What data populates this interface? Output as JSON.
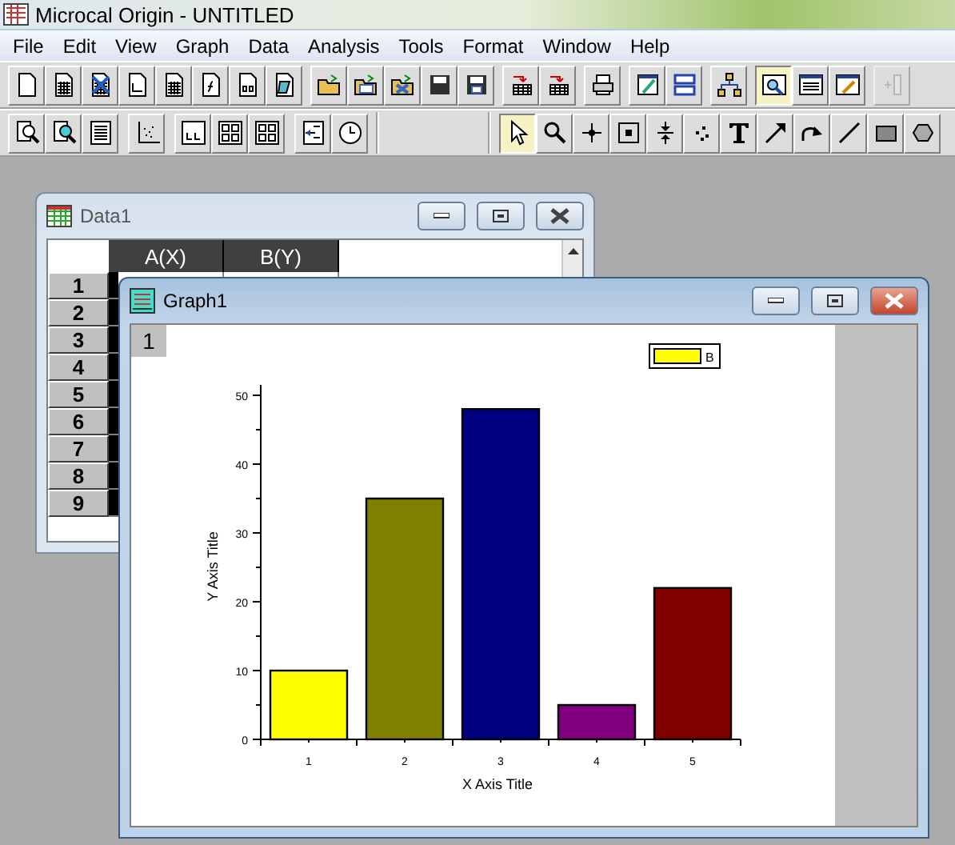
{
  "window": {
    "title": "Microcal Origin - UNTITLED"
  },
  "menu": [
    "File",
    "Edit",
    "View",
    "Graph",
    "Data",
    "Analysis",
    "Tools",
    "Format",
    "Window",
    "Help"
  ],
  "standard_toolbar": [
    {
      "on": false,
      "disabled": false
    },
    {
      "on": false,
      "disabled": false
    },
    {
      "on": false,
      "disabled": false
    },
    {
      "on": false,
      "disabled": false
    },
    {
      "on": false,
      "disabled": false
    },
    {
      "on": false,
      "disabled": false
    },
    {
      "on": false,
      "disabled": false
    },
    {
      "on": false,
      "disabled": false
    },
    {
      "on": false,
      "disabled": false
    },
    {
      "on": false,
      "disabled": false
    },
    {
      "on": false,
      "disabled": false
    },
    {
      "on": false,
      "disabled": false
    },
    {
      "on": false,
      "disabled": false
    },
    {
      "on": false,
      "disabled": false
    },
    {
      "on": false,
      "disabled": false
    },
    {
      "on": false,
      "disabled": false
    },
    {
      "on": false,
      "disabled": false
    },
    {
      "on": false,
      "disabled": false
    },
    {
      "on": false,
      "disabled": false
    },
    {
      "on": true,
      "disabled": false
    },
    {
      "on": false,
      "disabled": false
    },
    {
      "on": false,
      "disabled": false
    },
    {
      "on": false,
      "disabled": true
    }
  ],
  "graph_toolbar": [
    {
      "on": false
    },
    {
      "on": false
    },
    {
      "on": false
    },
    {
      "on": false
    },
    {
      "on": false
    },
    {
      "on": false
    },
    {
      "on": false
    },
    {
      "on": false
    },
    {
      "on": false
    }
  ],
  "drawing_tools": [
    {
      "selected": true
    },
    {
      "selected": false
    },
    {
      "selected": false
    },
    {
      "selected": false
    },
    {
      "selected": false
    },
    {
      "selected": false
    },
    {
      "selected": false
    },
    {
      "selected": false
    },
    {
      "selected": false
    },
    {
      "selected": false
    },
    {
      "selected": false
    },
    {
      "selected": false
    }
  ],
  "worksheet": {
    "title": "Data1",
    "active": false,
    "columns": [
      {
        "label": "A(X)",
        "selected": true
      },
      {
        "label": "B(Y)",
        "selected": true
      }
    ],
    "rows": [
      "1",
      "2",
      "3",
      "4",
      "5",
      "6",
      "7",
      "8",
      "9"
    ]
  },
  "graph": {
    "title": "Graph1",
    "active": true,
    "layer": "1",
    "bars": [
      {
        "color": "#ffff00"
      },
      {
        "color": "#808000"
      },
      {
        "color": "#000080"
      },
      {
        "color": "#800080"
      },
      {
        "color": "#800000"
      }
    ],
    "chart_data": {
      "type": "bar",
      "xlabel": "X Axis Title",
      "ylabel": "Y Axis Title",
      "categories": [
        "1",
        "2",
        "3",
        "4",
        "5"
      ],
      "series": [
        {
          "name": "B",
          "values": [
            10,
            35,
            48,
            5,
            22
          ]
        }
      ],
      "ylim": [
        0,
        51.5
      ],
      "yticks": [
        0,
        10,
        20,
        30,
        40,
        50
      ]
    }
  }
}
